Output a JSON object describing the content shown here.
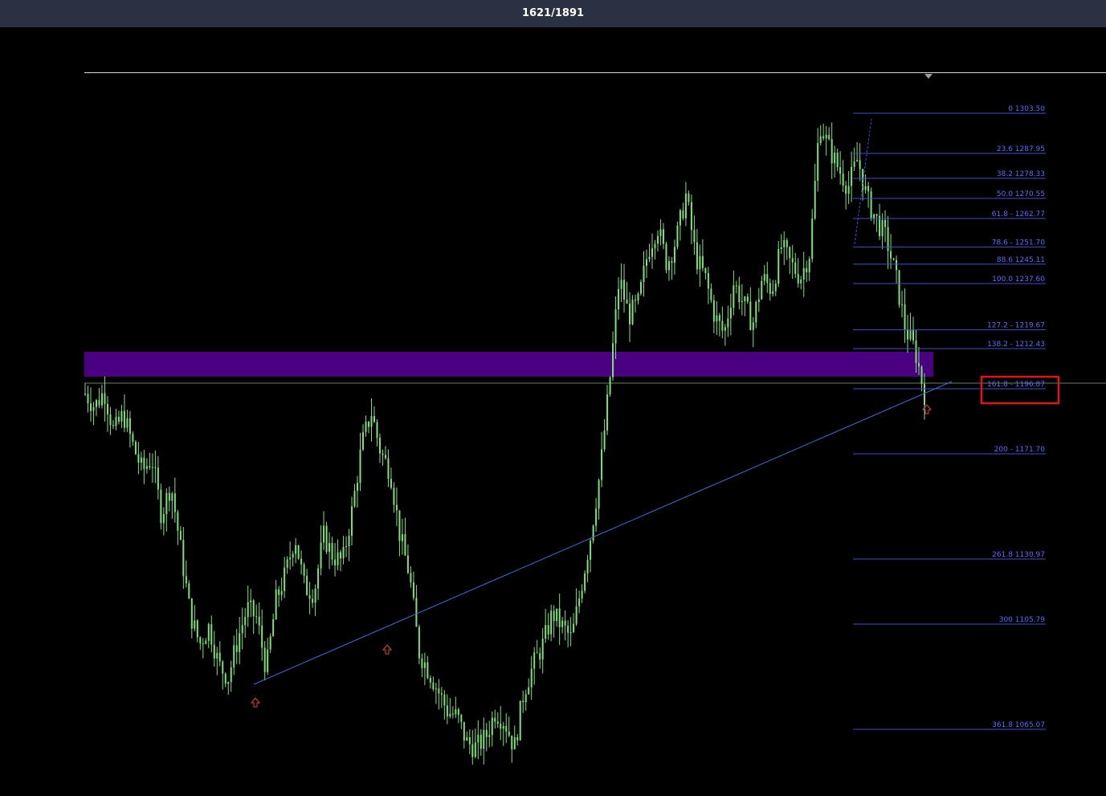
{
  "header": {
    "counter": "1621/1891"
  },
  "colors": {
    "background": "#000000",
    "header_bg": "#2a3142",
    "candle": "#7fe07a",
    "fib_line": "#3a4fd8",
    "fib_text": "#5b6cff",
    "trendline": "#3b6de6",
    "zone": "#4a0080",
    "arrow": "#e0463c",
    "highlight_box": "#e01414",
    "reference_line": "#d8d8d8"
  },
  "chart_data": {
    "type": "candlestick",
    "title": "",
    "price_range": [
      1035,
      1335
    ],
    "fib_levels": [
      {
        "label": "0 1303.50",
        "price": 1303.5
      },
      {
        "label": "23.6 1287.95",
        "price": 1287.95
      },
      {
        "label": "38.2 1278.33",
        "price": 1278.33
      },
      {
        "label": "50.0 1270.55",
        "price": 1270.55
      },
      {
        "label": "61.8 - 1262.77",
        "price": 1262.77
      },
      {
        "label": "78.6 - 1251.70",
        "price": 1251.7
      },
      {
        "label": "88.6 1245.11",
        "price": 1245.11
      },
      {
        "label": "100.0 1237.60",
        "price": 1237.6
      },
      {
        "label": "127.2 - 1219.67",
        "price": 1219.67
      },
      {
        "label": "138.2 - 1212.43",
        "price": 1212.43
      },
      {
        "label": "161.8 -  1196.87",
        "price": 1196.87,
        "highlighted": true
      },
      {
        "label": "200 - 1171.70",
        "price": 1171.7
      },
      {
        "label": "261.8 1130.97",
        "price": 1130.97
      },
      {
        "label": "300 1105.79",
        "price": 1105.79
      },
      {
        "label": "361.8 1065.07",
        "price": 1065.07
      }
    ],
    "support_zone": [
      1201,
      1218
    ],
    "price_path": [
      1195,
      1190,
      1196,
      1180,
      1187,
      1175,
      1165,
      1170,
      1148,
      1160,
      1135,
      1110,
      1098,
      1105,
      1090,
      1085,
      1100,
      1112,
      1108,
      1088,
      1115,
      1125,
      1140,
      1120,
      1118,
      1140,
      1132,
      1130,
      1150,
      1175,
      1188,
      1172,
      1165,
      1140,
      1125,
      1095,
      1088,
      1080,
      1072,
      1070,
      1060,
      1058,
      1062,
      1072,
      1068,
      1058,
      1080,
      1090,
      1098,
      1110,
      1105,
      1100,
      1120,
      1140,
      1165,
      1200,
      1240,
      1225,
      1230,
      1250,
      1260,
      1245,
      1255,
      1272,
      1248,
      1240,
      1225,
      1218,
      1238,
      1230,
      1222,
      1240,
      1235,
      1252,
      1245,
      1240,
      1250,
      1300,
      1290,
      1282,
      1275,
      1286,
      1270,
      1262,
      1255,
      1240,
      1220,
      1212,
      1195
    ]
  }
}
